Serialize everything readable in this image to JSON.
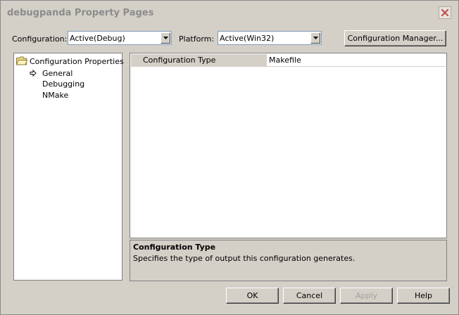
{
  "window": {
    "title": "debugpanda Property Pages"
  },
  "config": {
    "label": "Configuration:",
    "value": "Active(Debug)",
    "platform_label": "Platform:",
    "platform_value": "Active(Win32)",
    "manager_button": "Configuration Manager..."
  },
  "tree": {
    "root": "Configuration Properties",
    "items": [
      {
        "label": "General",
        "selected": true
      },
      {
        "label": "Debugging"
      },
      {
        "label": "NMake"
      }
    ]
  },
  "grid": {
    "rows": [
      {
        "name": "Configuration Type",
        "value": "Makefile"
      }
    ]
  },
  "description": {
    "title": "Configuration Type",
    "text": "Specifies the type of output this configuration generates."
  },
  "buttons": {
    "ok": "OK",
    "cancel": "Cancel",
    "apply": "Apply",
    "help": "Help"
  },
  "icons": [
    "close-icon",
    "dropdown-arrow-icon",
    "folder-open-icon",
    "arrow-right-icon"
  ]
}
